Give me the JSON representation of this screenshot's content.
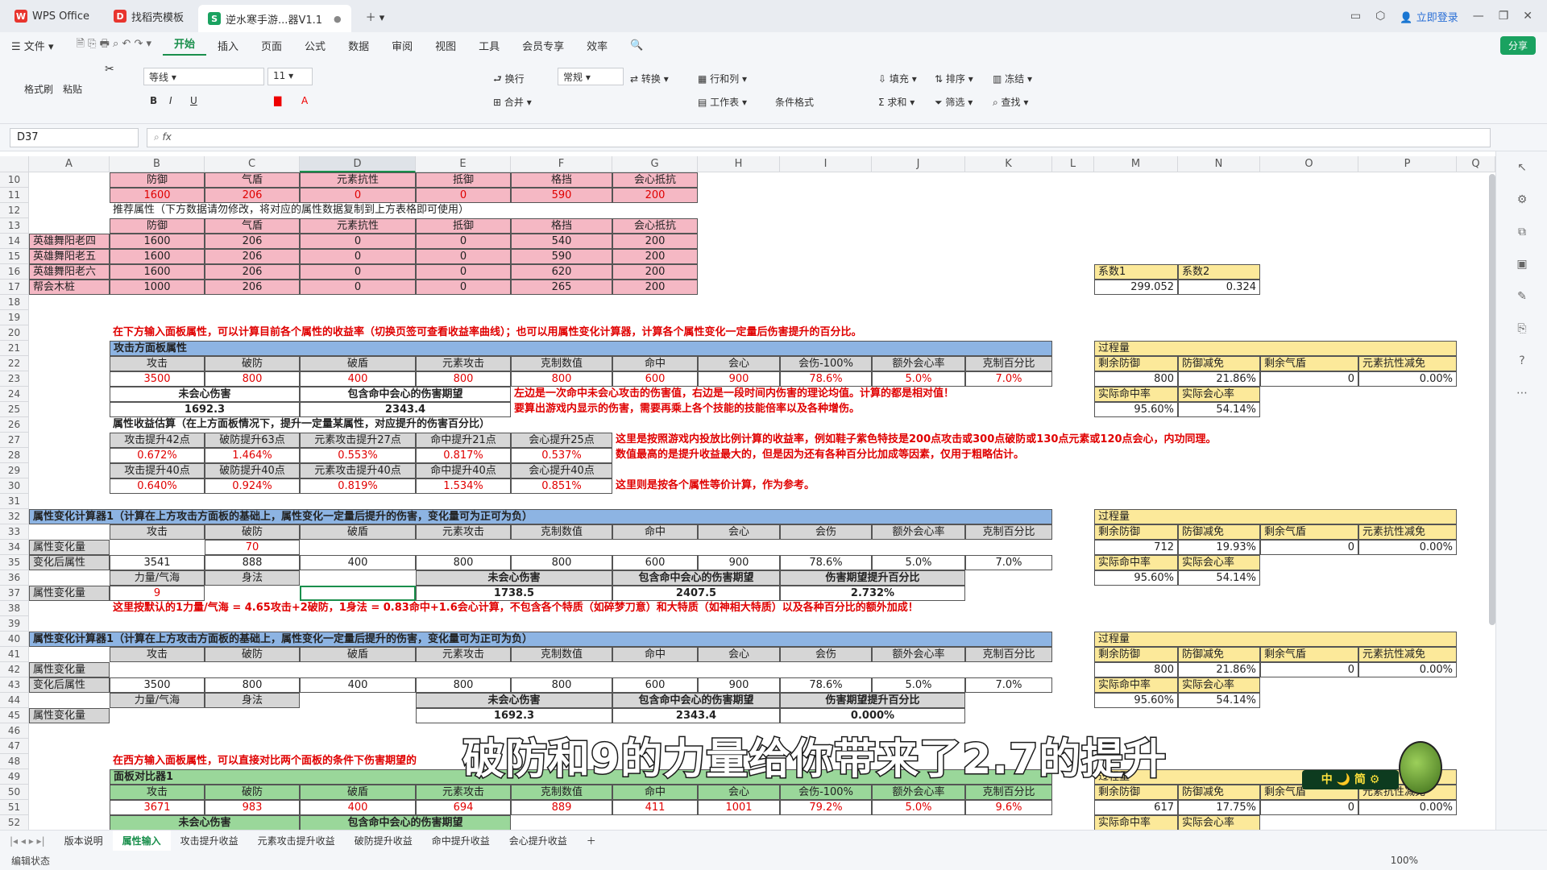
{
  "window": {
    "tabs": [
      {
        "label": "WPS Office",
        "icon": "wps-logo-icon"
      },
      {
        "label": "找稻壳模板",
        "icon": "docer-logo-icon"
      },
      {
        "label": "逆水寒手游...器V1.1",
        "icon": "sheet-logo-icon"
      }
    ],
    "login": "立即登录"
  },
  "menu": {
    "file": "文件",
    "items": [
      "开始",
      "插入",
      "页面",
      "公式",
      "数据",
      "审阅",
      "视图",
      "工具",
      "会员专享",
      "效率"
    ],
    "share": "分享"
  },
  "ribbon": {
    "format_painter": "格式刷",
    "paste": "粘贴",
    "font": "等线",
    "size": "11",
    "wrap": "换行",
    "merge": "合并",
    "number_format": "常规",
    "convert": "转换",
    "row_col": "行和列",
    "worksheet": "工作表",
    "cond_format": "条件格式",
    "fill": "填充",
    "sort": "排序",
    "freeze": "冻结",
    "sum": "求和",
    "filter": "筛选",
    "find": "查找"
  },
  "formula": {
    "cell_ref": "D37",
    "fx": "fx"
  },
  "columns": [
    "A",
    "B",
    "C",
    "D",
    "E",
    "F",
    "G",
    "H",
    "I",
    "J",
    "K",
    "L",
    "M",
    "N",
    "O",
    "P",
    "Q"
  ],
  "rows": [
    "10",
    "11",
    "12",
    "13",
    "14",
    "15",
    "16",
    "17",
    "18",
    "19",
    "20",
    "21",
    "22",
    "23",
    "24",
    "25",
    "26",
    "27",
    "28",
    "29",
    "30",
    "31",
    "32",
    "33",
    "34",
    "35",
    "36",
    "37",
    "38",
    "39",
    "40",
    "41",
    "42",
    "43",
    "44",
    "45",
    "46",
    "47",
    "48",
    "49",
    "50",
    "51",
    "52"
  ],
  "cells": {
    "r10": [
      "防御",
      "气盾",
      "元素抗性",
      "抵御",
      "格挡",
      "会心抵抗"
    ],
    "r11": [
      "1600",
      "206",
      "0",
      "0",
      "590",
      "200"
    ],
    "r12": "推荐属性（下方数据请勿修改，将对应的属性数据复制到上方表格即可使用）",
    "r13": [
      "防御",
      "气盾",
      "元素抗性",
      "抵御",
      "格挡",
      "会心抵抗"
    ],
    "r14": [
      "英雄舞阳老四",
      "1600",
      "206",
      "0",
      "0",
      "540",
      "200"
    ],
    "r15": [
      "英雄舞阳老五",
      "1600",
      "206",
      "0",
      "0",
      "590",
      "200"
    ],
    "r16": [
      "英雄舞阳老六",
      "1600",
      "206",
      "0",
      "0",
      "620",
      "200"
    ],
    "r17": [
      "帮会木桩",
      "1000",
      "206",
      "0",
      "0",
      "265",
      "200"
    ],
    "coef_hdr": [
      "系数1",
      "系数2"
    ],
    "coef_val": [
      "299.052",
      "0.324"
    ],
    "r20": "在下方输入面板属性，可以计算目前各个属性的收益率（切换页签可查看收益率曲线）；也可以用属性变化计算器，计算各个属性变化一定量后伤害提升的百分比。",
    "r21": "攻击方面板属性",
    "r22": [
      "攻击",
      "破防",
      "破盾",
      "元素攻击",
      "克制数值",
      "命中",
      "会心",
      "会伤-100%",
      "额外会心率",
      "克制百分比"
    ],
    "r23": [
      "3500",
      "800",
      "400",
      "800",
      "800",
      "600",
      "900",
      "78.6%",
      "5.0%",
      "7.0%"
    ],
    "r24": [
      "未会心伤害",
      "包含命中会心的伤害期望"
    ],
    "r24_note": "左边是一次命中未会心攻击的伤害值，右边是一段时间内伤害的理论均值。计算的都是相对值！",
    "r25": [
      "1692.3",
      "2343.4"
    ],
    "r25_note": "要算出游戏内显示的伤害，需要再乘上各个技能的技能倍率以及各种增伤。",
    "r26": "属性收益估算（在上方面板情况下，提升一定量某属性，对应提升的伤害百分比）",
    "r27": [
      "攻击提升42点",
      "破防提升63点",
      "元素攻击提升27点",
      "命中提升21点",
      "会心提升25点"
    ],
    "r27_note": "这里是按照游戏内投放比例计算的收益率，例如鞋子紫色特技是200点攻击或300点破防或130点元素或120点会心，内功同理。",
    "r28": [
      "0.672%",
      "1.464%",
      "0.553%",
      "0.817%",
      "0.537%"
    ],
    "r28_note": "数值最高的是提升收益最大的，但是因为还有各种百分比加成等因素，仅用于粗略估计。",
    "r29": [
      "攻击提升40点",
      "破防提升40点",
      "元素攻击提升40点",
      "命中提升40点",
      "会心提升40点"
    ],
    "r30": [
      "0.640%",
      "0.924%",
      "0.819%",
      "1.534%",
      "0.851%"
    ],
    "r30_note": "这里则是按各个属性等价计算，作为参考。",
    "r32": "属性变化计算器1（计算在上方攻击方面板的基础上，属性变化一定量后提升的伤害，变化量可为正可为负）",
    "r33": [
      "攻击",
      "破防",
      "破盾",
      "元素攻击",
      "克制数值",
      "命中",
      "会心",
      "会伤",
      "额外会心率",
      "克制百分比"
    ],
    "r34_label": "属性变化量",
    "r34_val": "70",
    "r35_label": "变化后属性",
    "r35": [
      "3541",
      "888",
      "400",
      "800",
      "800",
      "600",
      "900",
      "78.6%",
      "5.0%",
      "7.0%"
    ],
    "r36": [
      "力量/气海",
      "身法",
      "未会心伤害",
      "包含命中会心的伤害期望",
      "伤害期望提升百分比"
    ],
    "r37_label": "属性变化量",
    "r37": [
      "9",
      "1738.5",
      "2407.5",
      "2.732%"
    ],
    "r38": "这里按默认的1力量/气海 = 4.65攻击+2破防，1身法 = 0.83命中+1.6会心计算，不包含各个特质（如碎梦刀意）和大特质（如神相大特质）以及各种百分比的额外加成！",
    "proc_hdr": "过程量",
    "proc_cols": [
      "剩余防御",
      "防御减免",
      "剩余气盾",
      "元素抗性减免"
    ],
    "proc1": [
      "800",
      "21.86%",
      "0",
      "0.00%"
    ],
    "proc_cols2": [
      "实际命中率",
      "实际会心率"
    ],
    "proc1b": [
      "95.60%",
      "54.14%"
    ],
    "proc2": [
      "712",
      "19.93%",
      "0",
      "0.00%"
    ],
    "proc2b": [
      "95.60%",
      "54.14%"
    ],
    "r40": "属性变化计算器1（计算在上方攻击方面板的基础上，属性变化一定量后提升的伤害，变化量可为正可为负）",
    "r41": [
      "攻击",
      "破防",
      "破盾",
      "元素攻击",
      "克制数值",
      "命中",
      "会心",
      "会伤",
      "额外会心率",
      "克制百分比"
    ],
    "r42_label": "属性变化量",
    "r43_label": "变化后属性",
    "r43": [
      "3500",
      "800",
      "400",
      "800",
      "800",
      "600",
      "900",
      "78.6%",
      "5.0%",
      "7.0%"
    ],
    "r44": [
      "力量/气海",
      "身法",
      "未会心伤害",
      "包含命中会心的伤害期望",
      "伤害期望提升百分比"
    ],
    "r45_label": "属性变化量",
    "r45": [
      "1692.3",
      "2343.4",
      "0.000%"
    ],
    "proc3": [
      "800",
      "21.86%",
      "0",
      "0.00%"
    ],
    "proc3b": [
      "95.60%",
      "54.14%"
    ],
    "r48": "在西方输入面板属性，可以直接对比两个面板的条件下伤害期望的",
    "r49": "面板对比器1",
    "r50": [
      "攻击",
      "破防",
      "破盾",
      "元素攻击",
      "克制数值",
      "命中",
      "会心",
      "会伤-100%",
      "额外会心率",
      "克制百分比"
    ],
    "r51": [
      "3671",
      "983",
      "400",
      "694",
      "889",
      "411",
      "1001",
      "79.2%",
      "5.0%",
      "9.6%"
    ],
    "r52": [
      "未会心伤害",
      "包含命中会心的伤害期望"
    ],
    "proc4": [
      "617",
      "17.75%",
      "0",
      "0.00%"
    ]
  },
  "sheets": [
    "版本说明",
    "属性输入",
    "攻击提升收益",
    "元素攻击提升收益",
    "破防提升收益",
    "命中提升收益",
    "会心提升收益"
  ],
  "status": {
    "mode": "编辑状态",
    "zoom": "100%"
  },
  "subtitle": "破防和9的力量给你带来了2.7的提升",
  "watermark": "中 🌙 简 ⚙"
}
